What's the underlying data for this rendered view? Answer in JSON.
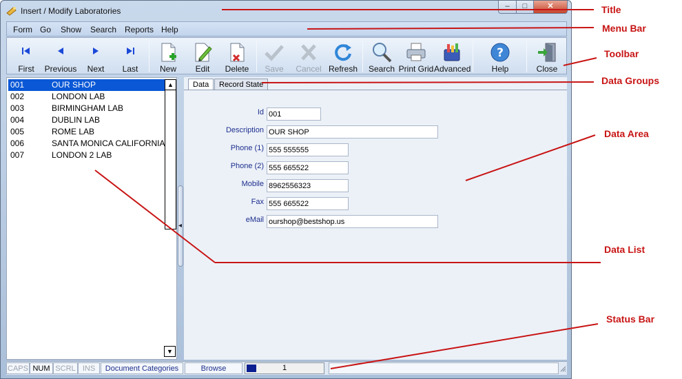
{
  "window": {
    "title": "Insert / Modify Laboratories",
    "minimize_glyph": "‒",
    "maximize_glyph": "□",
    "close_glyph": "✕"
  },
  "menu": [
    "Form",
    "Go",
    "Show",
    "Search",
    "Reports",
    "Help"
  ],
  "toolbar": {
    "first": "First",
    "previous": "Previous",
    "next": "Next",
    "last": "Last",
    "new": "New",
    "edit": "Edit",
    "delete": "Delete",
    "save": "Save",
    "cancel": "Cancel",
    "refresh": "Refresh",
    "search": "Search",
    "print_grid": "Print Grid",
    "advanced": "Advanced",
    "help": "Help",
    "close": "Close"
  },
  "list": {
    "rows": [
      {
        "code": "001",
        "name": "OUR SHOP"
      },
      {
        "code": "002",
        "name": "LONDON LAB"
      },
      {
        "code": "003",
        "name": "BIRMINGHAM LAB"
      },
      {
        "code": "004",
        "name": "DUBLIN LAB"
      },
      {
        "code": "005",
        "name": "ROME LAB"
      },
      {
        "code": "006",
        "name": "SANTA MONICA CALIFORNIA"
      },
      {
        "code": "007",
        "name": "LONDON 2 LAB"
      }
    ],
    "selected_index": 0
  },
  "tabs": [
    "Data",
    "Record State"
  ],
  "form": {
    "id_label": "Id",
    "id_value": "001",
    "description_label": "Description",
    "description_value": "OUR SHOP",
    "phone1_label": "Phone (1)",
    "phone1_value": "555 555555",
    "phone2_label": "Phone (2)",
    "phone2_value": "555 665522",
    "mobile_label": "Mobile",
    "mobile_value": "8962556323",
    "fax_label": "Fax",
    "fax_value": "555 665522",
    "email_label": "eMail",
    "email_value": "ourshop@bestshop.us"
  },
  "statusbar": {
    "caps": "CAPS",
    "num": "NUM",
    "scrl": "SCRL",
    "ins": "INS",
    "document": "Document Categories",
    "mode": "Browse",
    "record": "1"
  },
  "annotations": {
    "title": "Title",
    "menu_bar": "Menu Bar",
    "toolbar": "Toolbar",
    "data_groups": "Data Groups",
    "data_area": "Data Area",
    "data_list": "Data List",
    "status_bar": "Status Bar"
  },
  "colors": {
    "accent_selected": "#0a58d6",
    "annotation": "#c81414",
    "label_text": "#1c2e8c"
  }
}
